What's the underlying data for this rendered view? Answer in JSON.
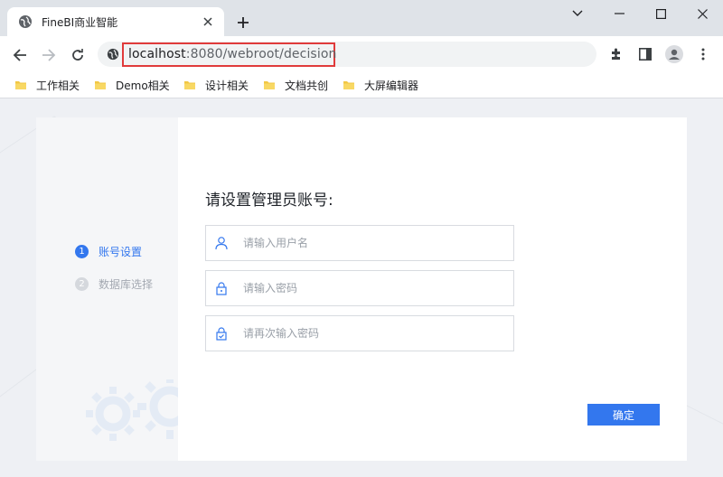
{
  "browser": {
    "tab_title": "FineBI商业智能",
    "url_host": "localhost",
    "url_path": ":8080/webroot/decision",
    "bookmarks": [
      "工作相关",
      "Demo相关",
      "设计相关",
      "文档共创",
      "大屏编辑器"
    ]
  },
  "page": {
    "steps": [
      {
        "number": "1",
        "label": "账号设置",
        "active": true
      },
      {
        "number": "2",
        "label": "数据库选择",
        "active": false
      }
    ],
    "form_title": "请设置管理员账号:",
    "fields": {
      "username_placeholder": "请输入用户名",
      "password_placeholder": "请输入密码",
      "confirm_password_placeholder": "请再次输入密码"
    },
    "confirm_label": "确定"
  },
  "colors": {
    "accent": "#3377ee",
    "url_highlight": "#e03b3b",
    "step_inactive": "#a3a8b1"
  }
}
